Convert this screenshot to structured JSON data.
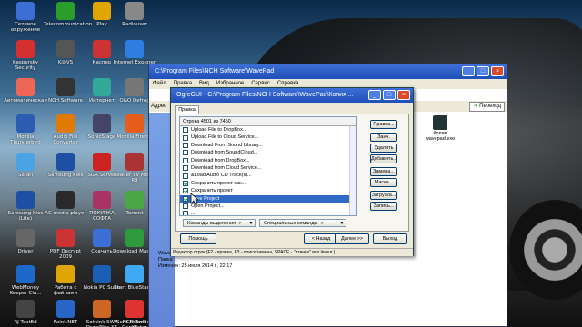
{
  "desktop_icons": [
    {
      "label": "Сетевое окружение",
      "icon": "network-icon"
    },
    {
      "label": "Telecommunication",
      "icon": "telecom-icon"
    },
    {
      "label": "Play",
      "icon": "play-icon"
    },
    {
      "label": "Radiouser",
      "icon": "radio-icon"
    },
    {
      "label": "Kaspersky Security",
      "icon": "kaspersky-icon"
    },
    {
      "label": "K@VS",
      "icon": "kav-icon"
    },
    {
      "label": "Каспер",
      "icon": "k-icon"
    },
    {
      "label": "Internet Explorer",
      "icon": "ie-icon"
    },
    {
      "label": "Автоматическая",
      "icon": "auto-icon"
    },
    {
      "label": "NCH Software",
      "icon": "nch-icon"
    },
    {
      "label": "Интернет",
      "icon": "internet-icon"
    },
    {
      "label": "O&O Defrag",
      "icon": "defrag-icon"
    },
    {
      "label": "Mozilla Thunderbird",
      "icon": "thunderbird-icon"
    },
    {
      "label": "Audio File Converter",
      "icon": "audio-converter-icon"
    },
    {
      "label": "SonicStage",
      "icon": "sonic-icon"
    },
    {
      "label": "Mozilla Firefox",
      "icon": "firefox-icon"
    },
    {
      "label": "Safari",
      "icon": "safari-icon"
    },
    {
      "label": "Samsung Kies",
      "icon": "kies-icon"
    },
    {
      "label": "SGR Server",
      "icon": "sgr-icon"
    },
    {
      "label": "Reader TV Movie R3",
      "icon": "reader-icon"
    },
    {
      "label": "Samsung Kies (Lite)",
      "icon": "kies-lite-icon"
    },
    {
      "label": "AC media player",
      "icon": "acmedia-icon"
    },
    {
      "label": "ПОКУПКА СОФТА",
      "icon": "shop-icon"
    },
    {
      "label": "Torrent",
      "icon": "torrent-icon"
    },
    {
      "label": "Driver",
      "icon": "driver-icon"
    },
    {
      "label": "PDF Decrypt 2009",
      "icon": "pdf-icon"
    },
    {
      "label": "Скачать",
      "icon": "download-icon"
    },
    {
      "label": "Download Master",
      "icon": "dm-icon"
    },
    {
      "label": "WebMoney Keeper Cla...",
      "icon": "webmoney-icon"
    },
    {
      "label": "Работа с файлами",
      "icon": "files-icon"
    },
    {
      "label": "Nokia PC Suite",
      "icon": "nokia-icon"
    },
    {
      "label": "Start BlueStacks",
      "icon": "bluestacks-icon"
    },
    {
      "label": "RJ TextEd",
      "icon": "rjtext-icon"
    },
    {
      "label": "Paint.NET",
      "icon": "paint-icon"
    },
    {
      "label": "Sothink SWF DrawPlus X6",
      "icon": "drawplus-icon"
    },
    {
      "label": "Serif DrawPlus X5",
      "icon": "drawplus5-icon"
    },
    {
      "label": "NCH Tone Generator",
      "icon": "tone-icon"
    }
  ],
  "explorer": {
    "title": "C:\\Program Files\\NCH Software\\WavePad",
    "menu": [
      "Файл",
      "Правка",
      "Вид",
      "Избранное",
      "Сервис",
      "Справка"
    ],
    "address_label": "Адрес",
    "go_label": "Переход",
    "file_label": "Копия wavepad.exe",
    "details": [
      "Wave",
      "Папка",
      "Изменен: 25 июля 2014 г., 22:17"
    ]
  },
  "ogre": {
    "title": "OgreGUI - C:\\Program Files\\NCH Software\\WavePad\\Копия ...",
    "tab_label": "Правка",
    "list_header": "Строка 4501 из 7450",
    "rows": [
      {
        "label": "Upload File to DropBox...",
        "checked": false,
        "selected": false
      },
      {
        "label": "Upload File to Cloud Service...",
        "checked": false,
        "selected": false
      },
      {
        "label": "Download From Sound Library...",
        "checked": false,
        "selected": false
      },
      {
        "label": "Download from SoundCloud...",
        "checked": false,
        "selected": false
      },
      {
        "label": "Download from DropBox...",
        "checked": false,
        "selected": false
      },
      {
        "label": "Download from Cloud Service...",
        "checked": false,
        "selected": false
      },
      {
        "label": "&Load Audio CD Track(s)...",
        "checked": false,
        "selected": false
      },
      {
        "label": "Сохранить проект как...",
        "checked": true,
        "selected": false
      },
      {
        "label": "Сохранить проект",
        "checked": true,
        "selected": false
      },
      {
        "label": "Save Project",
        "checked": true,
        "selected": true
      },
      {
        "label": "Open Project...",
        "checked": false,
        "selected": false
      },
      {
        "label": "...",
        "checked": false,
        "selected": false
      }
    ],
    "side_buttons": [
      "Правка...",
      "Занч.",
      "Удалить",
      "Добавить...",
      "Замена...",
      "Маска...",
      "Загрузка...",
      "Запись..."
    ],
    "combo_left": "Команды выделения ->",
    "combo_right": "Специальные команды ->",
    "help": "Помощь",
    "back": "< Назад",
    "next": "Далее >>",
    "exit": "Выход",
    "status": "Редактор строк (F2 - правка, F3 - поиск/замена, SPACE - \"птичка\" вкл./выкл.)"
  }
}
